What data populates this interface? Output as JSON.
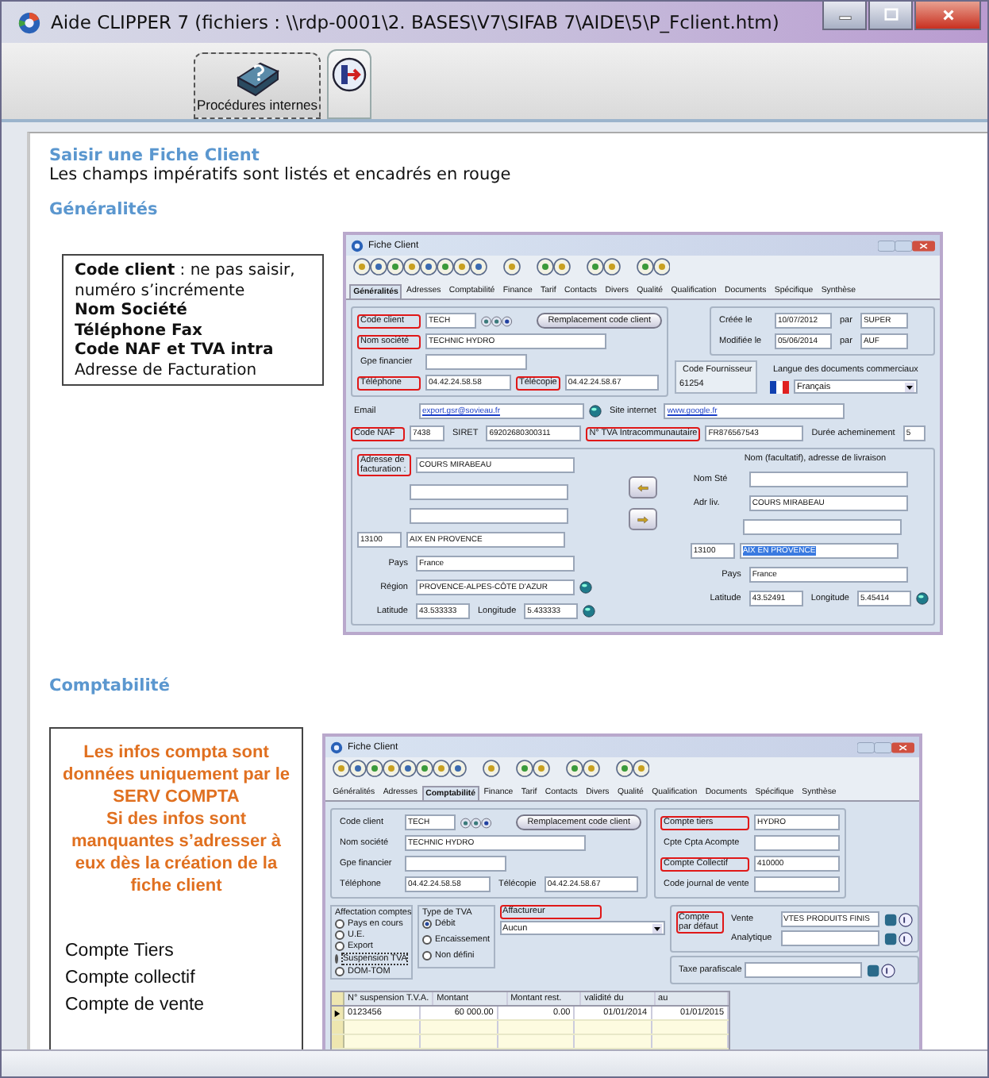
{
  "window": {
    "title": "Aide CLIPPER 7 (fichiers : \\\\rdp-0001\\2. BASES\\V7\\SIFAB 7\\AIDE\\5\\P_Fclient.htm)"
  },
  "toolbar": [
    {
      "kind": "help",
      "label": "Procédures internes"
    },
    {
      "kind": "exit"
    }
  ],
  "page": {
    "title": "Saisir une Fiche Client",
    "intro": "Les champs impératifs sont listés et encadrés en rouge"
  },
  "sections": [
    {
      "title": "Généralités",
      "note": [
        {
          "text": "**Code client** : ne pas saisir, numéro s’incrémente",
          "bold": false
        },
        {
          "text": "Nom Société",
          "bold": true
        },
        {
          "text": "Téléphone Fax",
          "bold": true
        },
        {
          "text": "Code NAF et TVA intra",
          "bold": true
        },
        {
          "text": "Adresse de Facturation",
          "bold": false
        }
      ],
      "form": {
        "title": "Fiche Client",
        "tabs": [
          {
            "label": "Généralités",
            "selected": true
          },
          {
            "label": "Adresses",
            "selected": false
          },
          {
            "label": "Comptabilité",
            "selected": false
          },
          {
            "label": "Finance",
            "selected": false
          },
          {
            "label": "Tarif",
            "selected": false
          },
          {
            "label": "Contacts",
            "selected": false
          },
          {
            "label": "Divers",
            "selected": false
          },
          {
            "label": "Qualité",
            "selected": false
          },
          {
            "label": "Qualification",
            "selected": false
          },
          {
            "label": "Documents",
            "selected": false
          },
          {
            "label": "Spécifique",
            "selected": false
          },
          {
            "label": "Synthèse",
            "selected": false
          }
        ],
        "code_client": {
          "label": "Code client",
          "value": "TECH",
          "highlight": true
        },
        "replace_button": "Remplacement code client",
        "nom_societe": {
          "label": "Nom société",
          "value": "TECHNIC HYDRO",
          "highlight": true
        },
        "gpe_financier": {
          "label": "Gpe financier",
          "highlight": false
        },
        "telephone": {
          "label": "Téléphone",
          "value": "04.42.24.58.58",
          "highlight": true
        },
        "telecopie": {
          "label": "Télécopie",
          "value": "04.42.24.58.67",
          "highlight": true
        },
        "creee": {
          "label": "Créée le",
          "value": "10/07/2012"
        },
        "creee_par": {
          "label": "par",
          "value": "SUPER"
        },
        "modifiee": {
          "label": "Modifiée le",
          "value": "05/06/2014"
        },
        "modifiee_par": {
          "label": "par",
          "value": "AUF"
        },
        "code_fournisseur": {
          "label": "Code Fournisseur",
          "value": "61254"
        },
        "langue": {
          "label": "Langue des documents commerciaux",
          "value": "Français"
        },
        "email": {
          "label": "Email",
          "value": "export.gsr@sovieau.fr"
        },
        "site": {
          "label": "Site internet",
          "value": "www.google.fr"
        },
        "code_naf": {
          "label": "Code NAF",
          "value": "7438",
          "highlight": true
        },
        "siret": {
          "label": "SIRET",
          "value": "69202680300311"
        },
        "tva": {
          "label": "N° TVA Intracommunautaire",
          "value": "FR876567543",
          "highlight": true
        },
        "duree": {
          "label": "Durée acheminement",
          "value": "5"
        },
        "billing": {
          "label": "Adresse de facturation :",
          "highlight": true,
          "line1": "COURS MIRABEAU",
          "zip": "13100",
          "city": "AIX EN PROVENCE",
          "country": {
            "label": "Pays",
            "value": "France"
          },
          "region": {
            "label": "Région",
            "value": "PROVENCE-ALPES-CÔTE D'AZUR"
          },
          "lat": {
            "label": "Latitude",
            "value": "43.533333"
          },
          "lon": {
            "label": "Longitude",
            "value": "5.433333"
          }
        },
        "delivery": {
          "header": "Nom (facultatif), adresse de livraison",
          "name": {
            "label": "Nom Sté"
          },
          "line1": {
            "label": "Adr liv.",
            "value": "COURS MIRABEAU"
          },
          "zip": "13100",
          "city": "AIX EN PROVENCE",
          "city_selected": true,
          "country": {
            "label": "Pays",
            "value": "France"
          },
          "lat": {
            "label": "Latitude",
            "value": "43.52491"
          },
          "lon": {
            "label": "Longitude",
            "value": "5.45414"
          }
        }
      }
    },
    {
      "title": "Comptabilité",
      "note": {
        "warning": [
          "Les infos compta sont données uniquement par le SERV COMPTA",
          "Si des infos sont manquantes s’adresser à eux dès la création de la fiche client"
        ],
        "items": [
          "Compte Tiers",
          "Compte collectif",
          "Compte de vente"
        ]
      },
      "form": {
        "title": "Fiche Client",
        "tabs": [
          {
            "label": "Généralités",
            "selected": false
          },
          {
            "label": "Adresses",
            "selected": false
          },
          {
            "label": "Comptabilité",
            "selected": true
          },
          {
            "label": "Finance",
            "selected": false
          },
          {
            "label": "Tarif",
            "selected": false
          },
          {
            "label": "Contacts",
            "selected": false
          },
          {
            "label": "Divers",
            "selected": false
          },
          {
            "label": "Qualité",
            "selected": false
          },
          {
            "label": "Qualification",
            "selected": false
          },
          {
            "label": "Documents",
            "selected": false
          },
          {
            "label": "Spécifique",
            "selected": false
          },
          {
            "label": "Synthèse",
            "selected": false
          }
        ],
        "code_client": {
          "label": "Code client",
          "value": "TECH",
          "highlight": false
        },
        "replace_button": "Remplacement code client",
        "nom_societe": {
          "label": "Nom société",
          "value": "TECHNIC HYDRO",
          "highlight": false
        },
        "gpe_financier": {
          "label": "Gpe financier",
          "highlight": false
        },
        "telephone": {
          "label": "Téléphone",
          "value": "04.42.24.58.58",
          "highlight": false
        },
        "telecopie": {
          "label": "Télécopie",
          "value": "04.42.24.58.67",
          "highlight": false
        },
        "compte_tiers": {
          "label": "Compte tiers",
          "value": "HYDRO",
          "highlight": true
        },
        "acompte": {
          "label": "Cpte Cpta Acompte",
          "highlight": false
        },
        "collectif": {
          "label": "Compte Collectif",
          "value": "410000",
          "highlight": true
        },
        "journal": {
          "label": "Code journal de vente",
          "highlight": false
        },
        "affectation": {
          "title": "Affectation comptes",
          "options": [
            {
              "label": "Pays en cours",
              "selected": false
            },
            {
              "label": "U.E.",
              "selected": false
            },
            {
              "label": "Export",
              "selected": false
            },
            {
              "label": "Suspension TVA",
              "selected": true
            },
            {
              "label": "DOM-TOM",
              "selected": false
            }
          ]
        },
        "type_tva": {
          "title": "Type de TVA",
          "options": [
            {
              "label": "Débit",
              "selected": true
            },
            {
              "label": "Encaissement",
              "selected": false
            },
            {
              "label": "Non défini",
              "selected": false
            }
          ]
        },
        "affactureur": {
          "label": "Affactureur",
          "value": "Aucun",
          "highlight": true
        },
        "default_account": {
          "label": "Compte par défaut",
          "highlight": true,
          "rows": [
            {
              "label": "Vente",
              "value": "VTES PRODUITS FINIS"
            },
            {
              "label": "Analytique"
            }
          ]
        },
        "taxe": {
          "label": "Taxe parafiscale"
        },
        "table": {
          "columns": [
            "N° suspension T.V.A.",
            "Montant",
            "Montant rest.",
            "validité du",
            "au"
          ],
          "rows": [
            [
              "0123456",
              "60 000.00",
              "0.00",
              "01/01/2014",
              "01/01/2015"
            ]
          ]
        }
      }
    }
  ]
}
